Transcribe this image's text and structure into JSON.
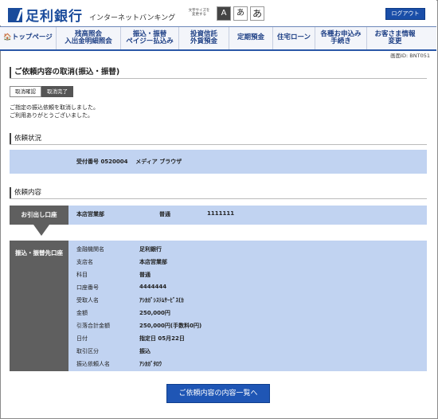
{
  "header": {
    "brand": "足利銀行",
    "subtitle": "インターネットバンキング",
    "fontsize_label": "文字サイズを変更する",
    "font_buttons": [
      "A",
      "あ",
      "あ"
    ],
    "logout_label": "ログアウト"
  },
  "nav": {
    "items": [
      {
        "label": "🏠トップページ"
      },
      {
        "label": "残高照会\n入出金明細照会"
      },
      {
        "label": "振込・振替\nペイジー払込み"
      },
      {
        "label": "投資信託\n外貨預金"
      },
      {
        "label": "定期預金"
      },
      {
        "label": "住宅ローン"
      },
      {
        "label": "各種お申込み\n手続き"
      },
      {
        "label": "お客さま情報\n変更"
      }
    ]
  },
  "screen_id": "画面ID: BNT051",
  "page_title": "ご依頼内容の取消(振込・振替)",
  "steps": [
    "取消確認",
    "取消完了"
  ],
  "messages": [
    "ご指定の振込依頼を取消しました。",
    "ご利用ありがとうございました。"
  ],
  "status_section": {
    "title": "依頼状況",
    "receipt_label": "受付番号",
    "receipt_no": "0520004",
    "media_label": "メディア",
    "media_value": "ブラウザ"
  },
  "detail_section": {
    "title": "依頼内容",
    "source_label": "お引出し口座",
    "source_branch": "本店営業部",
    "source_type": "普通",
    "source_number": "1111111",
    "dest_label": "振込・振替先口座",
    "rows": [
      {
        "key": "金融機関名",
        "value": "足利銀行"
      },
      {
        "key": "支店名",
        "value": "本店営業部"
      },
      {
        "key": "科目",
        "value": "普通"
      },
      {
        "key": "口座番号",
        "value": "4444444"
      },
      {
        "key": "受取人名",
        "value": "ｱｼｶｶﾞｼｽﾃﾑｻｰﾋﾞｽ(ｶ"
      },
      {
        "key": "金額",
        "value": "250,000円"
      },
      {
        "key": "引落合計金額",
        "value": "250,000円(手数料0円)"
      },
      {
        "key": "日付",
        "value": "指定日 05月22日"
      },
      {
        "key": "取引区分",
        "value": "振込"
      },
      {
        "key": "振込依頼人名",
        "value": "ｱｼｶｶﾞﾀﾛｳ"
      }
    ]
  },
  "list_button_label": "ご依頼内容の内容一覧へ",
  "colors": {
    "brand": "#1a4b9b",
    "panel": "#c1d3f1",
    "dark": "#5f5f5f",
    "button": "#1f56b5"
  }
}
